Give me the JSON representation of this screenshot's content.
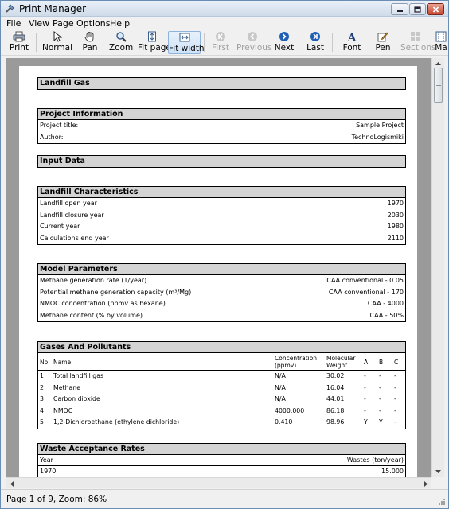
{
  "window": {
    "title": "Print Manager"
  },
  "menu": [
    "File",
    "View",
    "Page",
    "Options",
    "Help"
  ],
  "toolbar": {
    "print": "Print",
    "normal": "Normal",
    "pan": "Pan",
    "zoom": "Zoom",
    "fit_page": "Fit page",
    "fit_width": "Fit width",
    "first": "First",
    "previous": "Previous",
    "next": "Next",
    "last": "Last",
    "font": "Font",
    "pen": "Pen",
    "sections": "Sections",
    "margins": "Ma"
  },
  "report": {
    "title": "Landfill Gas",
    "project": {
      "heading": "Project Information",
      "rows": [
        {
          "label": "Project title:",
          "value": "Sample Project"
        },
        {
          "label": "Author:",
          "value": "TechnoLogismiki"
        }
      ]
    },
    "input_heading": "Input Data",
    "characteristics": {
      "heading": "Landfill Characteristics",
      "rows": [
        {
          "label": "Landfill open year",
          "value": "1970"
        },
        {
          "label": "Landfill closure year",
          "value": "2030"
        },
        {
          "label": "Current year",
          "value": "1980"
        },
        {
          "label": "Calculations end year",
          "value": "2110"
        }
      ]
    },
    "model": {
      "heading": "Model Parameters",
      "rows": [
        {
          "label": "Methane generation rate (1/year)",
          "value": "CAA conventional - 0.05"
        },
        {
          "label": "Potential methane generation capacity (m³/Mg)",
          "value": "CAA conventional - 170"
        },
        {
          "label": "NMOC concentration (ppmv as hexane)",
          "value": "CAA - 4000"
        },
        {
          "label": "Methane content (% by volume)",
          "value": "CAA - 50%"
        }
      ]
    },
    "gases": {
      "heading": "Gases And Pollutants",
      "columns": {
        "no": "No",
        "name": "Name",
        "conc_1": "Concentration",
        "conc_2": "(ppmv)",
        "mw_1": "Molecular",
        "mw_2": "Weight",
        "a": "A",
        "b": "B",
        "c": "C"
      },
      "rows": [
        {
          "no": "1",
          "name": "Total landfill gas",
          "conc": "N/A",
          "mw": "30.02",
          "a": "-",
          "b": "-",
          "c": "-"
        },
        {
          "no": "2",
          "name": "Methane",
          "conc": "N/A",
          "mw": "16.04",
          "a": "-",
          "b": "-",
          "c": "-"
        },
        {
          "no": "3",
          "name": "Carbon dioxide",
          "conc": "N/A",
          "mw": "44.01",
          "a": "-",
          "b": "-",
          "c": "-"
        },
        {
          "no": "4",
          "name": "NMOC",
          "conc": "4000.000",
          "mw": "86.18",
          "a": "-",
          "b": "-",
          "c": "-"
        },
        {
          "no": "5",
          "name": "1,2-Dichloroethane (ethylene dichloride)",
          "conc": "0.410",
          "mw": "98.96",
          "a": "Y",
          "b": "Y",
          "c": "-"
        }
      ]
    },
    "waste": {
      "heading": "Waste Acceptance Rates",
      "col_year": "Year",
      "col_wastes": "Wastes (ton/year)",
      "rows": [
        {
          "year": "1970",
          "wastes": "15.000"
        }
      ]
    }
  },
  "status": "Page 1 of 9, Zoom: 86%"
}
